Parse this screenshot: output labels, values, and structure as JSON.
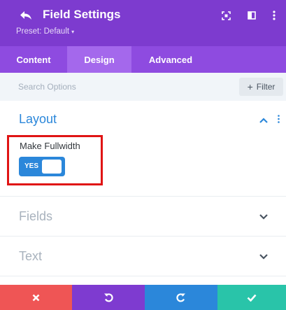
{
  "header": {
    "title": "Field Settings",
    "preset_label": "Preset: Default",
    "icons": [
      "back-icon",
      "focus-icon",
      "split-view-icon",
      "more-vertical-icon"
    ],
    "bg_color": "#7d3bcf"
  },
  "tabs": [
    {
      "label": "Content",
      "active": false
    },
    {
      "label": "Design",
      "active": true
    },
    {
      "label": "Advanced",
      "active": false
    }
  ],
  "search": {
    "placeholder": "Search Options",
    "filter_label": "Filter"
  },
  "sections": {
    "layout": {
      "title": "Layout",
      "expanded": true,
      "make_fullwidth": {
        "label": "Make Fullwidth",
        "toggle_text": "YES",
        "value": true
      }
    },
    "fields": {
      "title": "Fields",
      "expanded": false
    },
    "text": {
      "title": "Text",
      "expanded": false
    }
  },
  "footer": {
    "buttons": [
      {
        "name": "discard",
        "icon": "close-icon",
        "color": "#ef5555"
      },
      {
        "name": "undo",
        "icon": "undo-icon",
        "color": "#7e3bd0"
      },
      {
        "name": "redo",
        "icon": "redo-icon",
        "color": "#2b87da"
      },
      {
        "name": "save",
        "icon": "check-icon",
        "color": "#29c4a9"
      }
    ]
  },
  "colors": {
    "accent_purple": "#7d3bcf",
    "tab_bar": "#8e4be0",
    "active_tab": "#a468ec",
    "blue": "#2b87da",
    "highlight_red": "#e01414"
  }
}
